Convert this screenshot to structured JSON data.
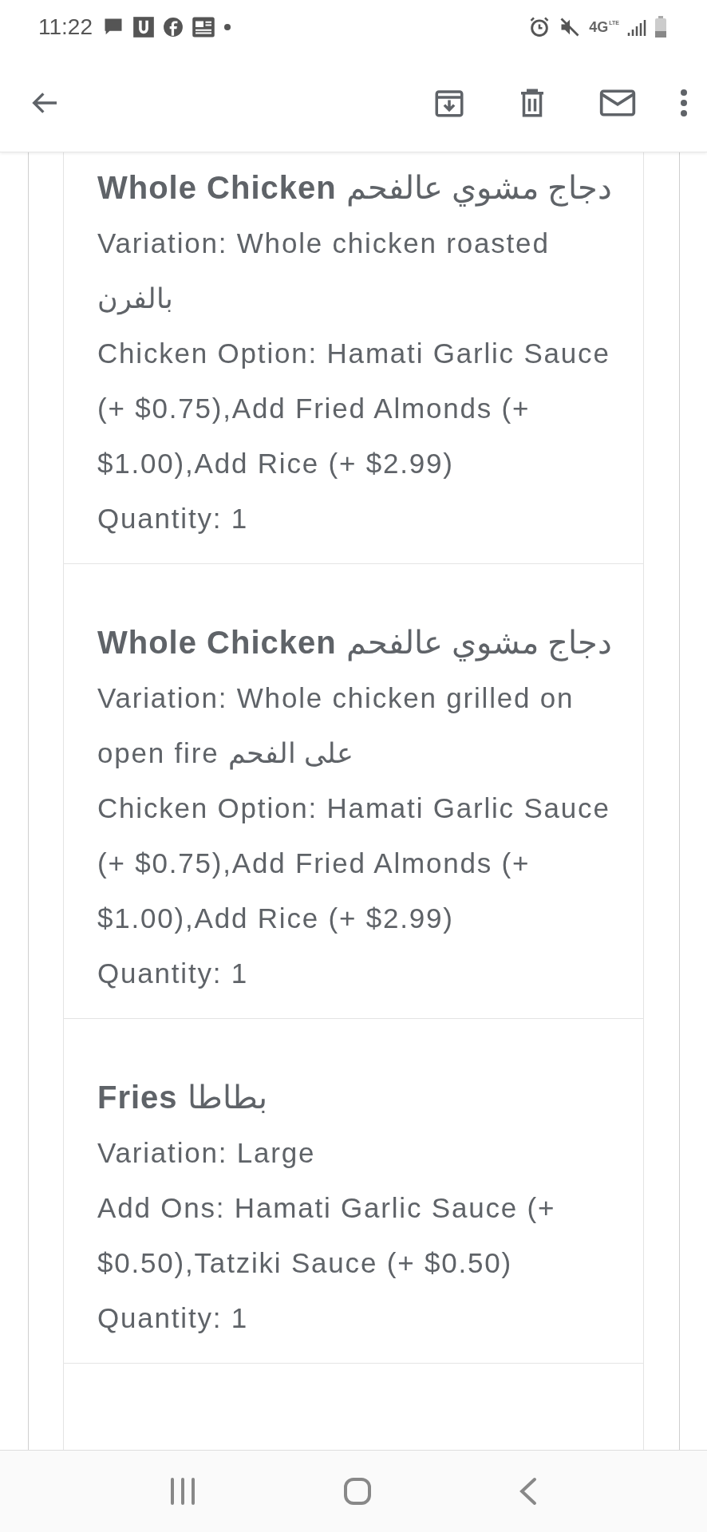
{
  "status_bar": {
    "time": "11:22",
    "network_type": "4G",
    "network_sub": "LTE"
  },
  "items": [
    {
      "title": "**Whole Chicken** دجاج مشوي عالفحم",
      "lines": [
        "Variation: Whole chicken roasted بالفرن",
        "Chicken Option: Hamati Garlic Sauce (+ $0.75),Add Fried Almonds (+ $1.00),Add Rice (+ $2.99)",
        "Quantity: 1"
      ]
    },
    {
      "title": "**Whole Chicken** دجاج مشوي عالفحم",
      "lines": [
        "Variation: Whole chicken grilled on open fire على الفحم",
        "Chicken Option: Hamati Garlic Sauce (+ $0.75),Add Fried Almonds (+ $1.00),Add Rice (+ $2.99)",
        "Quantity: 1"
      ]
    },
    {
      "title": "**Fries** بطاطا",
      "lines": [
        "Variation: Large",
        "Add Ons: Hamati Garlic Sauce (+ $0.50),Tatziki Sauce (+ $0.50)",
        "Quantity: 1"
      ]
    }
  ]
}
